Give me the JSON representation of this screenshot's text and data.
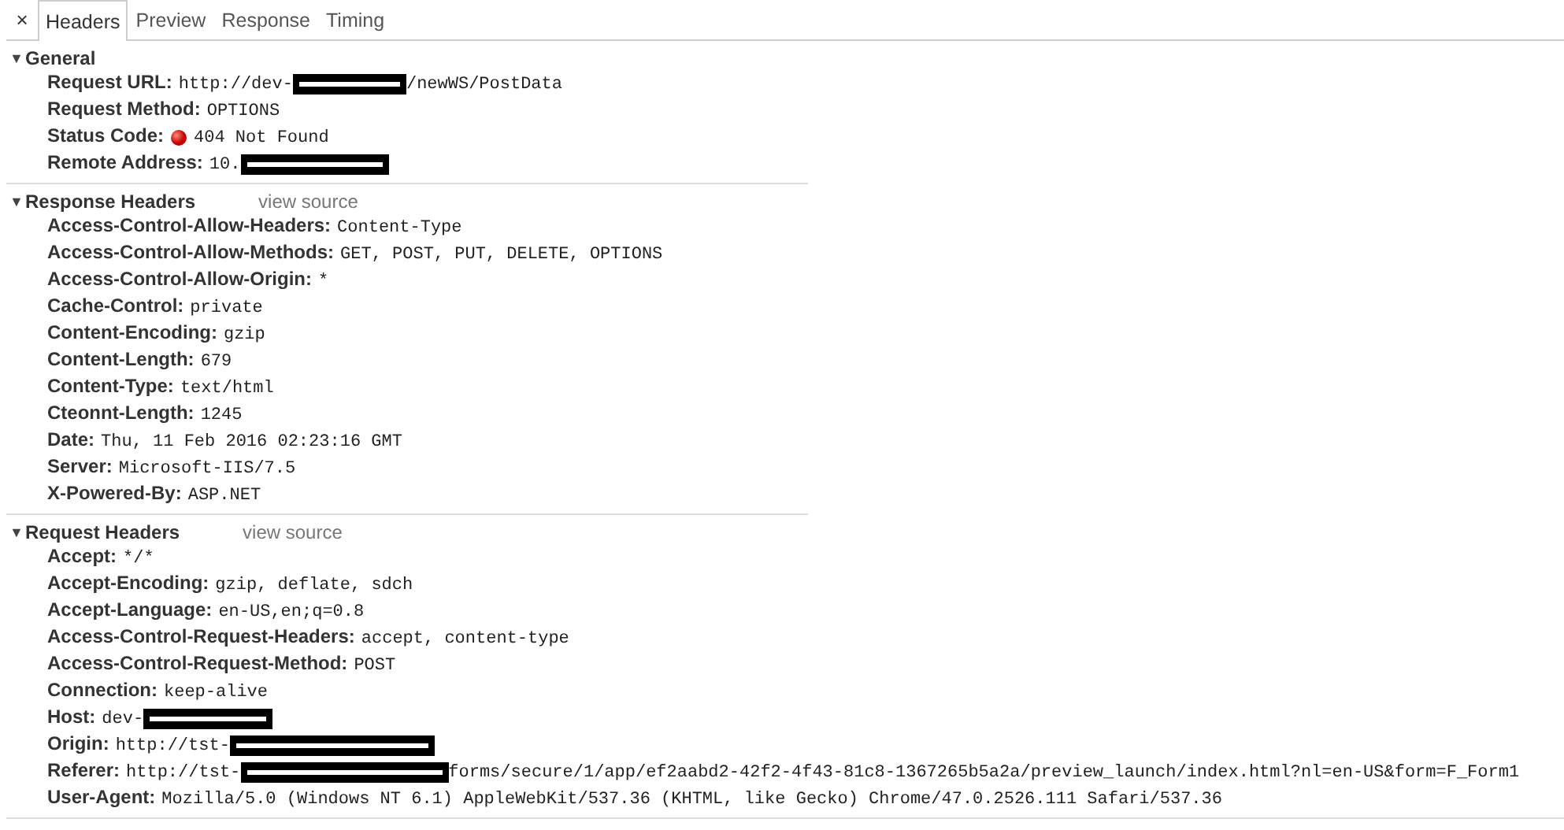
{
  "tabs": {
    "close": "×",
    "items": [
      {
        "label": "Headers",
        "selected": true
      },
      {
        "label": "Preview",
        "selected": false
      },
      {
        "label": "Response",
        "selected": false
      },
      {
        "label": "Timing",
        "selected": false
      }
    ]
  },
  "sections": [
    {
      "toggle": "▼",
      "title": "General",
      "expanded": true,
      "rows": [
        {
          "name": "Request URL:",
          "kind": "plain",
          "value": [
            {
              "kind": "text",
              "text": "http://dev-"
            },
            {
              "kind": "redaction"
            },
            {
              "kind": "text",
              "text": "/newWS/PostData"
            }
          ]
        },
        {
          "name": "Request Method:",
          "kind": "plain",
          "value": [
            {
              "kind": "text",
              "text": "OPTIONS"
            }
          ]
        },
        {
          "name": "Status Code:",
          "kind": "status",
          "value": [
            {
              "kind": "text",
              "text": "404 Not Found"
            }
          ]
        },
        {
          "name": "Remote Address:",
          "kind": "plain",
          "value": [
            {
              "kind": "text",
              "text": "10."
            },
            {
              "kind": "redaction"
            }
          ]
        }
      ]
    },
    {
      "toggle": "▼",
      "title": "Response Headers",
      "expanded": true,
      "link": "view source",
      "rows": [
        {
          "name": "Access-Control-Allow-Headers:",
          "kind": "plain",
          "value": [
            {
              "kind": "text",
              "text": "Content-Type"
            }
          ]
        },
        {
          "name": "Access-Control-Allow-Methods:",
          "kind": "plain",
          "value": [
            {
              "kind": "text",
              "text": "GET, POST, PUT, DELETE, OPTIONS"
            }
          ]
        },
        {
          "name": "Access-Control-Allow-Origin:",
          "kind": "plain",
          "value": [
            {
              "kind": "text",
              "text": "*"
            }
          ]
        },
        {
          "name": "Cache-Control:",
          "kind": "plain",
          "value": [
            {
              "kind": "text",
              "text": "private"
            }
          ]
        },
        {
          "name": "Content-Encoding:",
          "kind": "plain",
          "value": [
            {
              "kind": "text",
              "text": "gzip"
            }
          ]
        },
        {
          "name": "Content-Length:",
          "kind": "plain",
          "value": [
            {
              "kind": "text",
              "text": "679"
            }
          ]
        },
        {
          "name": "Content-Type:",
          "kind": "plain",
          "value": [
            {
              "kind": "text",
              "text": "text/html"
            }
          ]
        },
        {
          "name": "Cteonnt-Length:",
          "kind": "plain",
          "value": [
            {
              "kind": "text",
              "text": "1245"
            }
          ]
        },
        {
          "name": "Date:",
          "kind": "plain",
          "value": [
            {
              "kind": "text",
              "text": "Thu, 11 Feb 2016 02:23:16 GMT"
            }
          ]
        },
        {
          "name": "Server:",
          "kind": "plain",
          "value": [
            {
              "kind": "text",
              "text": "Microsoft-IIS/7.5"
            }
          ]
        },
        {
          "name": "X-Powered-By:",
          "kind": "plain",
          "value": [
            {
              "kind": "text",
              "text": "ASP.NET"
            }
          ]
        }
      ]
    },
    {
      "toggle": "▼",
      "title": "Request Headers",
      "expanded": true,
      "link": "view source",
      "rows": [
        {
          "name": "Accept:",
          "kind": "plain",
          "value": [
            {
              "kind": "text",
              "text": "*/*"
            }
          ]
        },
        {
          "name": "Accept-Encoding:",
          "kind": "plain",
          "value": [
            {
              "kind": "text",
              "text": "gzip, deflate, sdch"
            }
          ]
        },
        {
          "name": "Accept-Language:",
          "kind": "plain",
          "value": [
            {
              "kind": "text",
              "text": "en-US,en;q=0.8"
            }
          ]
        },
        {
          "name": "Access-Control-Request-Headers:",
          "kind": "plain",
          "value": [
            {
              "kind": "text",
              "text": "accept, content-type"
            }
          ]
        },
        {
          "name": "Access-Control-Request-Method:",
          "kind": "plain",
          "value": [
            {
              "kind": "text",
              "text": "POST"
            }
          ]
        },
        {
          "name": "Connection:",
          "kind": "plain",
          "value": [
            {
              "kind": "text",
              "text": "keep-alive"
            }
          ]
        },
        {
          "name": "Host:",
          "kind": "plain",
          "value": [
            {
              "kind": "text",
              "text": "dev-"
            },
            {
              "kind": "redaction"
            }
          ]
        },
        {
          "name": "Origin:",
          "kind": "plain",
          "value": [
            {
              "kind": "text",
              "text": "http://tst-"
            },
            {
              "kind": "redaction"
            }
          ]
        },
        {
          "name": "Referer:",
          "kind": "plain",
          "value": [
            {
              "kind": "text",
              "text": "http://tst-"
            },
            {
              "kind": "redaction"
            },
            {
              "kind": "text",
              "text": "forms/secure/1/app/ef2aabd2-42f2-4f43-81c8-1367265b5a2a/preview_launch/index.html?nl=en-US&form=F_Form1"
            }
          ]
        },
        {
          "name": "User-Agent:",
          "kind": "plain",
          "value": [
            {
              "kind": "text",
              "text": "Mozilla/5.0 (Windows NT 6.1) AppleWebKit/537.36 (KHTML, like Gecko) Chrome/47.0.2526.111 Safari/537.36"
            }
          ]
        }
      ]
    }
  ]
}
